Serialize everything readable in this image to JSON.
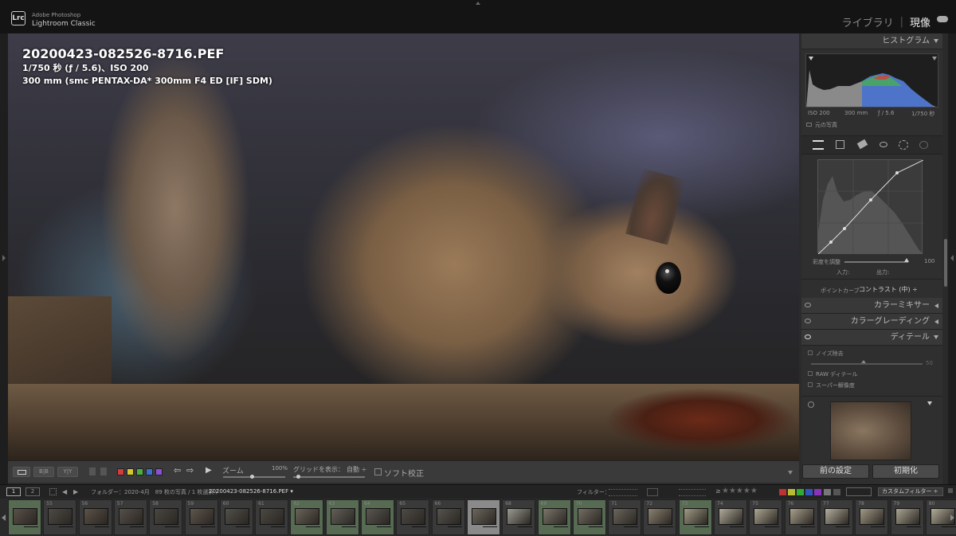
{
  "app": {
    "brand_line1": "Adobe Photoshop",
    "brand_line2": "Lightroom Classic",
    "logo": "Lrc",
    "modules": [
      "ライブラリ",
      "現像"
    ],
    "active_module": "現像",
    "module_sep": "|"
  },
  "overlay": {
    "filename": "20200423-082526-8716.PEF",
    "exposure": "1/750 秒 (ƒ / 5.6)、ISO 200",
    "lens": "300 mm (smc PENTAX-DA* 300mm F4 ED [IF] SDM)"
  },
  "toolbar": {
    "zoom_label": "ズーム",
    "zoom_value": "100%",
    "grid_label": "グリッドを表示：",
    "grid_value": "自動 ÷",
    "soft_proof_label": "ソフト校正",
    "view_modes": [
      "B|B",
      "Y|Y"
    ],
    "color_labels": [
      "#d43b3b",
      "#d6c82a",
      "#4caf3c",
      "#3b6fd4",
      "#8a4fd4"
    ]
  },
  "histogram": {
    "title": "ヒストグラム",
    "iso": "ISO 200",
    "focal": "300 mm",
    "aperture": "ƒ / 5.6",
    "shutter": "1/750 秒",
    "original_photo_label": "元の写真"
  },
  "tone_curve": {
    "saturation_label": "彩度を調整",
    "saturation_value": "100",
    "input_label": "入力:",
    "output_label": "出力:",
    "point_curve_label": "ポイントカーブ",
    "point_curve_value": "コントラスト (中) ÷"
  },
  "panels": {
    "color_mixer": "カラーミキサー",
    "color_grading": "カラーグレーディング",
    "detail": "ディテール"
  },
  "detail": {
    "noise_reduction": "ノイズ除去",
    "raw_detail": "RAW ディテール",
    "super_resolution": "スーパー解像度",
    "slider_value": "50"
  },
  "buttons": {
    "previous": "前の設定",
    "reset": "初期化"
  },
  "filmstrip_header": {
    "page1": "1",
    "page2": "2",
    "folder_info": "フォルダー：2020-4月　89 枚の写真 / 1 枚選択 /",
    "selected_file": "20200423-082526-8716.PEF ▾",
    "filter_label": "フィルター：",
    "custom_filter": "カスタムフィルター ÷",
    "rating_op": "≥",
    "stars": "★★★★★"
  },
  "filmstrip": {
    "cells": [
      {
        "num": "",
        "style": "green"
      },
      {
        "num": "55",
        "style": "normal"
      },
      {
        "num": "56",
        "style": "normal"
      },
      {
        "num": "57",
        "style": "normal"
      },
      {
        "num": "58",
        "style": "normal"
      },
      {
        "num": "59",
        "style": "normal"
      },
      {
        "num": "60",
        "style": "normal"
      },
      {
        "num": "61",
        "style": "normal"
      },
      {
        "num": "62",
        "style": "green"
      },
      {
        "num": "63",
        "style": "green"
      },
      {
        "num": "64",
        "style": "green"
      },
      {
        "num": "65",
        "style": "normal"
      },
      {
        "num": "66",
        "style": "normal"
      },
      {
        "num": "67",
        "style": "sel"
      },
      {
        "num": "68",
        "style": "normal"
      },
      {
        "num": "69",
        "style": "green"
      },
      {
        "num": "70",
        "style": "green"
      },
      {
        "num": "71",
        "style": "normal"
      },
      {
        "num": "72",
        "style": "normal"
      },
      {
        "num": "73",
        "style": "green"
      },
      {
        "num": "74",
        "style": "normal"
      },
      {
        "num": "75",
        "style": "normal"
      },
      {
        "num": "76",
        "style": "normal"
      },
      {
        "num": "77",
        "style": "normal"
      },
      {
        "num": "78",
        "style": "normal"
      },
      {
        "num": "79",
        "style": "normal"
      },
      {
        "num": "80",
        "style": "normal"
      }
    ]
  }
}
